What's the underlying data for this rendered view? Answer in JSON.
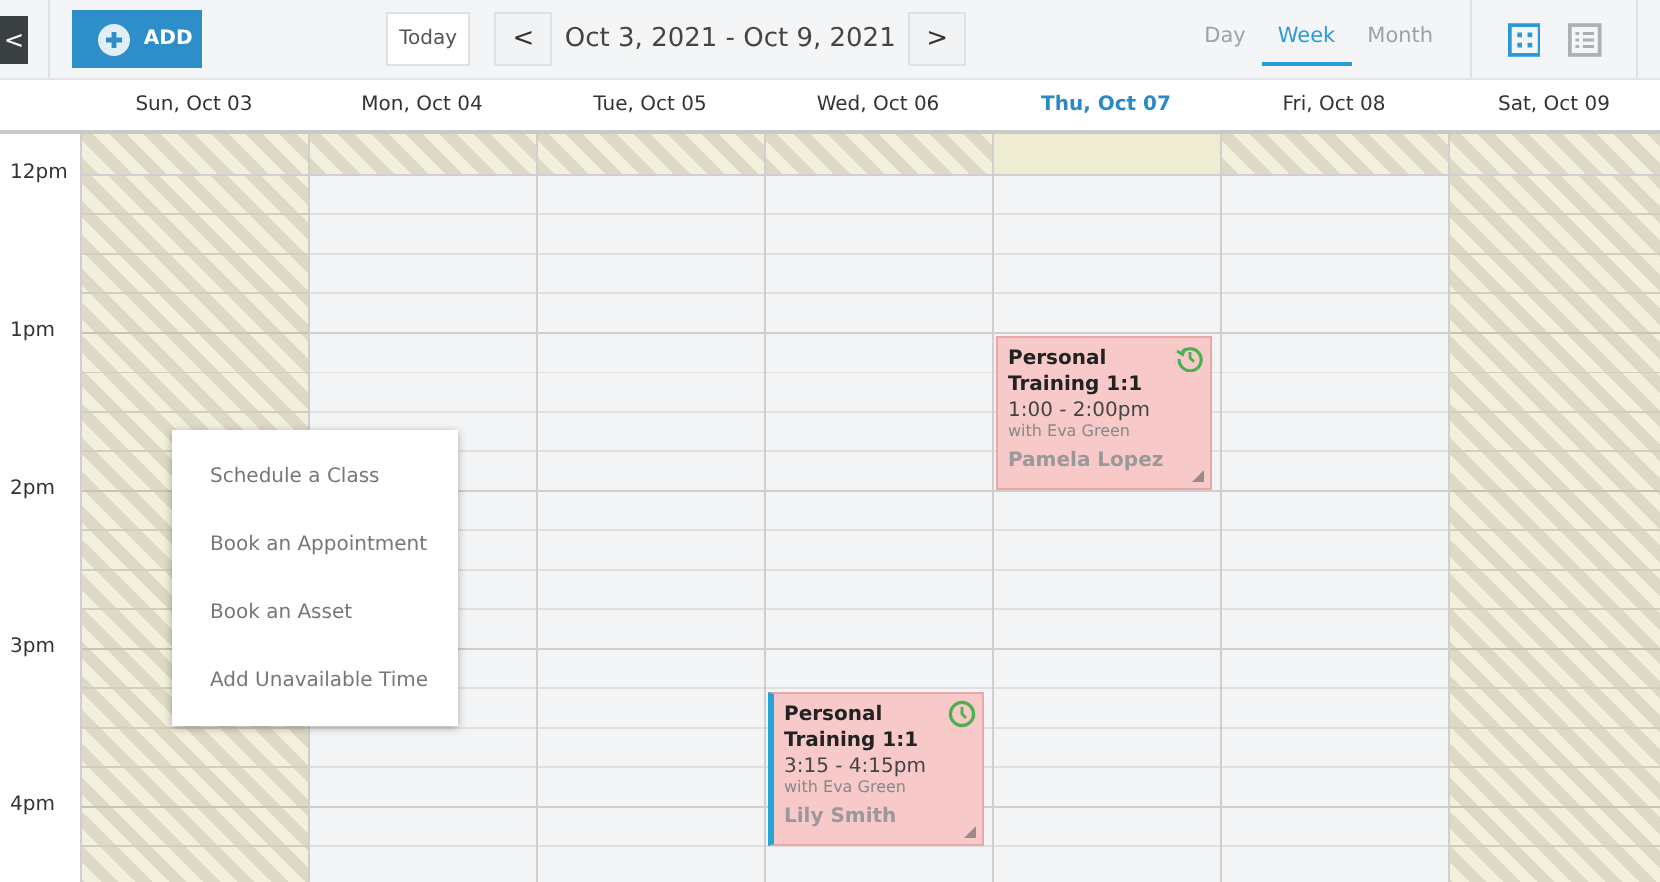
{
  "toolbar": {
    "back": "<",
    "add": "ADD",
    "today": "Today",
    "prev": "<",
    "range": "Oct 3, 2021 - Oct 9, 2021",
    "next": ">",
    "views": [
      {
        "label": "Day",
        "selected": false
      },
      {
        "label": "Week",
        "selected": true
      },
      {
        "label": "Month",
        "selected": false
      }
    ],
    "layouts": [
      {
        "kind": "grid",
        "selected": true
      },
      {
        "kind": "list",
        "selected": false
      }
    ]
  },
  "days": [
    {
      "label": "Sun, Oct 03",
      "today": false,
      "unavailable": true
    },
    {
      "label": "Mon, Oct 04",
      "today": false,
      "unavailable": false
    },
    {
      "label": "Tue, Oct 05",
      "today": false,
      "unavailable": false
    },
    {
      "label": "Wed, Oct 06",
      "today": false,
      "unavailable": false,
      "events": [
        {
          "title": "Personal Training 1:1",
          "time": "3:15 - 4:15pm",
          "staff": "with Eva Green",
          "client": "Lily Smith",
          "kind": "timed",
          "selected": true
        }
      ]
    },
    {
      "label": "Thu, Oct 07",
      "today": true,
      "unavailable": false,
      "events": [
        {
          "title": "Personal Training 1:1",
          "time": "1:00 - 2:00pm",
          "staff": "with Eva Green",
          "client": "Pamela Lopez",
          "kind": "recurring",
          "selected": false
        }
      ]
    },
    {
      "label": "Fri, Oct 08",
      "today": false,
      "unavailable": false
    },
    {
      "label": "Sat, Oct 09",
      "today": false,
      "unavailable": true
    }
  ],
  "hours": [
    "12pm",
    "1pm",
    "2pm",
    "3pm",
    "4pm"
  ],
  "context_menu": [
    "Schedule a Class",
    "Book an Appointment",
    "Book an Asset",
    "Add Unavailable Time"
  ]
}
